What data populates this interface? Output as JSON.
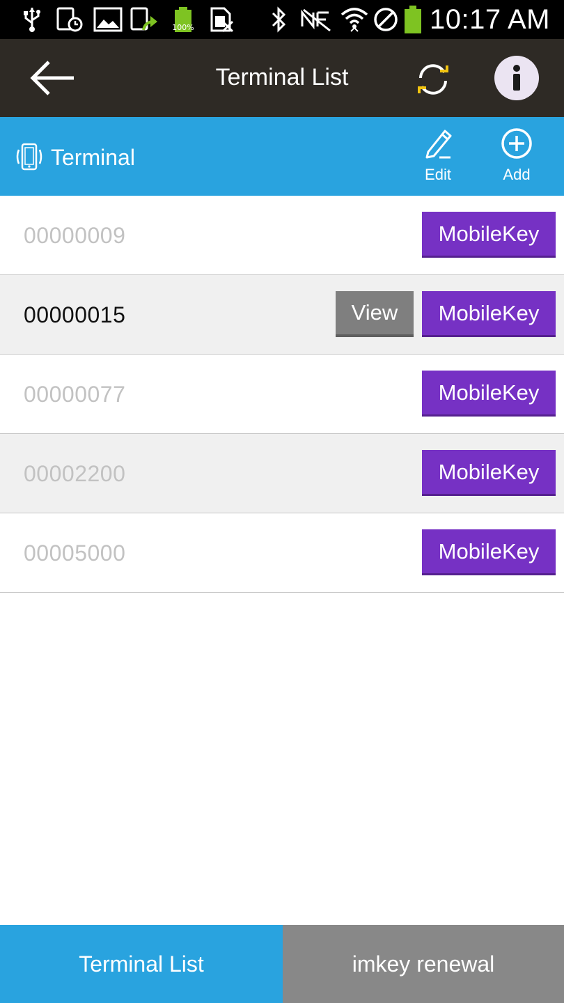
{
  "status_bar": {
    "time": "10:17 AM",
    "battery_badge": "100%"
  },
  "app_bar": {
    "title": "Terminal List"
  },
  "toolbar": {
    "section_label": "Terminal",
    "edit_label": "Edit",
    "add_label": "Add"
  },
  "terminals": [
    {
      "id": "00000009",
      "mobilekey_label": "MobileKey"
    },
    {
      "id": "00000015",
      "mobilekey_label": "MobileKey",
      "view_label": "View"
    },
    {
      "id": "00000077",
      "mobilekey_label": "MobileKey"
    },
    {
      "id": "00002200",
      "mobilekey_label": "MobileKey"
    },
    {
      "id": "00005000",
      "mobilekey_label": "MobileKey"
    }
  ],
  "bottom_tabs": {
    "terminal_list": "Terminal List",
    "imkey_renewal": "imkey renewal"
  },
  "colors": {
    "app_bar": "#2e2a25",
    "toolbar_blue": "#29a3df",
    "mobilekey_purple": "#7631c4",
    "view_gray": "#7f7f7f",
    "tab_inactive": "#888888"
  }
}
